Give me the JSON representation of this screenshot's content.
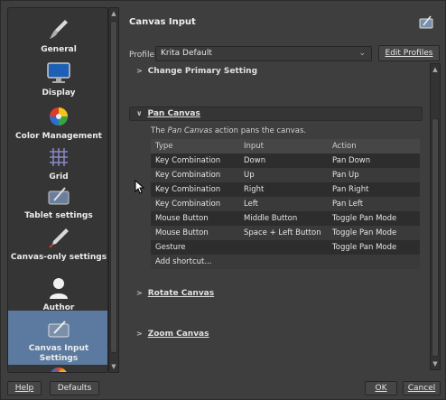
{
  "sidebar": {
    "items": [
      {
        "label": "General",
        "icon": "brush-icon"
      },
      {
        "label": "Display",
        "icon": "monitor-icon"
      },
      {
        "label": "Color Management",
        "icon": "color-wheel-icon"
      },
      {
        "label": "Grid",
        "icon": "grid-icon"
      },
      {
        "label": "Tablet settings",
        "icon": "tablet-icon"
      },
      {
        "label": "Canvas-only settings",
        "icon": "pen-icon"
      },
      {
        "label": "Author",
        "icon": "person-icon"
      },
      {
        "label": "Canvas Input Settings",
        "icon": "canvas-input-icon",
        "selected": true
      }
    ]
  },
  "header": {
    "title": "Canvas Input"
  },
  "profile": {
    "label": "Profile",
    "value": "Krita Default",
    "edit_label": "Edit Profiles"
  },
  "groups": {
    "change_primary": "Change Primary Setting",
    "pan_canvas": "Pan Canvas",
    "rotate_canvas": "Rotate Canvas",
    "zoom_canvas": "Zoom Canvas"
  },
  "pan": {
    "desc_prefix": "The ",
    "desc_action": "Pan Canvas",
    "desc_suffix": " action pans the canvas.",
    "columns": [
      "Type",
      "Input",
      "Action"
    ],
    "rows": [
      [
        "Key Combination",
        "Down",
        "Pan Down"
      ],
      [
        "Key Combination",
        "Up",
        "Pan Up"
      ],
      [
        "Key Combination",
        "Right",
        "Pan Right"
      ],
      [
        "Key Combination",
        "Left",
        "Pan Left"
      ],
      [
        "Mouse Button",
        "Middle Button",
        "Toggle Pan Mode"
      ],
      [
        "Mouse Button",
        "Space + Left Button",
        "Toggle Pan Mode"
      ],
      [
        "Gesture",
        "",
        "Toggle Pan Mode"
      ]
    ],
    "add_shortcut": "Add shortcut..."
  },
  "buttons": {
    "help": "Help",
    "defaults": "Defaults",
    "ok": "OK",
    "cancel": "Cancel"
  },
  "colors": {
    "selection": "#5c7aa0",
    "background": "#3e3e3e"
  }
}
